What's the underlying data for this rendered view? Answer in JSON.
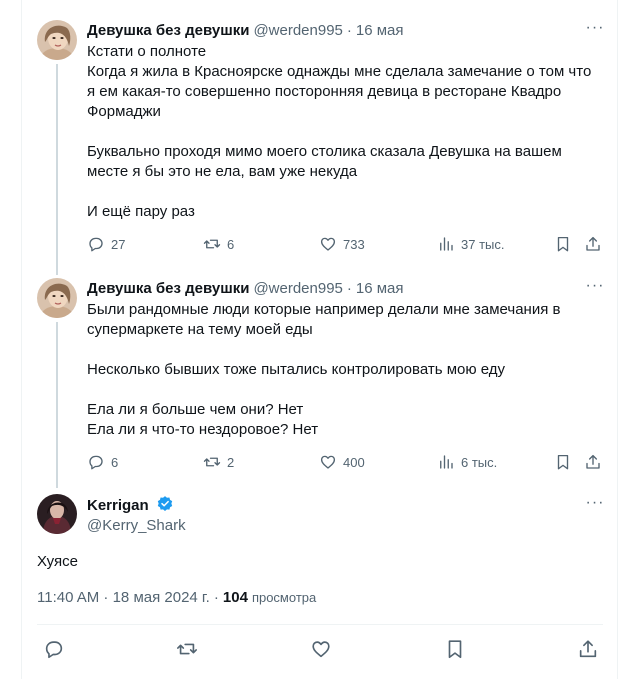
{
  "tweets": [
    {
      "name": "Девушка без девушки",
      "handle": "@werden995",
      "sep": "·",
      "date": "16 мая",
      "more": "···",
      "lines": [
        "Кстати о полноте",
        "Когда я жила в Красноярске однажды мне сделала замечание о том что я ем какая-то совершенно посторонняя девица в ресторане Квадро Формаджи",
        "",
        "Буквально проходя мимо моего столика сказала Девушка на вашем месте я бы это не ела, вам уже некуда",
        "",
        "И ещё пару раз"
      ],
      "replies": "27",
      "reposts": "6",
      "likes": "733",
      "views": "37 тыс."
    },
    {
      "name": "Девушка без девушки",
      "handle": "@werden995",
      "sep": "·",
      "date": "16 мая",
      "more": "···",
      "lines": [
        "Были рандомные люди которые например делали мне замечания в супермаркете на тему моей еды",
        "",
        "Несколько бывших тоже пытались контролировать мою еду",
        "",
        "Ела ли я больше чем они? Нет",
        "Ела ли я что-то нездоровое? Нет"
      ],
      "replies": "6",
      "reposts": "2",
      "likes": "400",
      "views": "6 тыс."
    }
  ],
  "main": {
    "name": "Kerrigan",
    "handle": "@Kerry_Shark",
    "more": "···",
    "text": "Хуясе",
    "time": "11:40 AM · 18 мая 2024 г. ·",
    "views_count": "104",
    "views_label": "просмотра"
  },
  "colors": {
    "text": "#0f1419",
    "secondary": "#536471",
    "verified": "#1d9bf0",
    "border": "#eff3f4"
  },
  "icons": [
    "reply-icon",
    "repost-icon",
    "like-icon",
    "views-icon",
    "bookmark-icon",
    "share-icon",
    "verified-badge-icon",
    "more-icon"
  ]
}
